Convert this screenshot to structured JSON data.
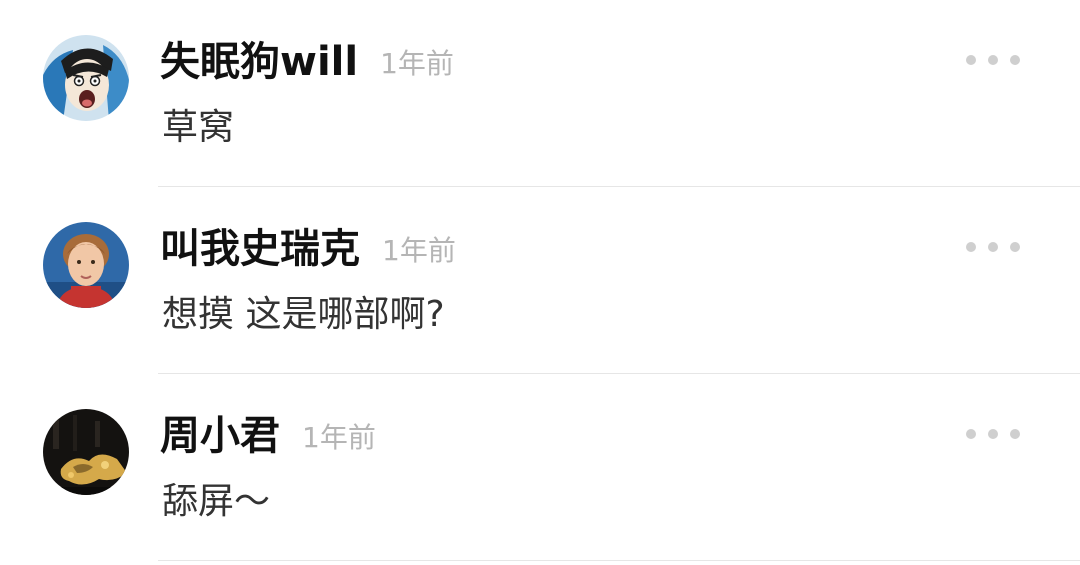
{
  "comments": [
    {
      "username": "失眠狗will",
      "time": "1年前",
      "text": "草窝",
      "avatar": "anime-face-avatar",
      "more_icon": "more-dots-icon"
    },
    {
      "username": "叫我史瑞克",
      "time": "1年前",
      "text": "想摸 这是哪部啊?",
      "avatar": "child-photo-avatar",
      "more_icon": "more-dots-icon"
    },
    {
      "username": "周小君",
      "time": "1年前",
      "text": "舔屏～",
      "avatar": "dark-photo-avatar",
      "more_icon": "more-dots-icon"
    }
  ]
}
